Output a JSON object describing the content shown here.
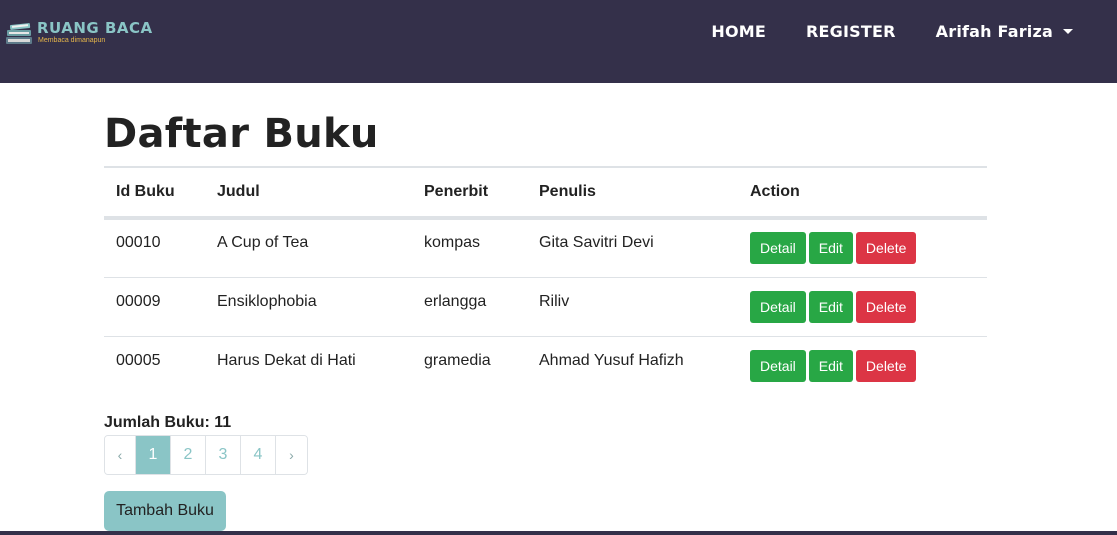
{
  "brand": {
    "name": "RUANG BACA",
    "tagline": "Membaca dimanapun"
  },
  "nav": {
    "home": "HOME",
    "register": "REGISTER",
    "user": "Arifah Fariza"
  },
  "page": {
    "title": "Daftar Buku"
  },
  "table": {
    "headers": {
      "id": "Id Buku",
      "judul": "Judul",
      "penerbit": "Penerbit",
      "penulis": "Penulis",
      "action": "Action"
    },
    "rows": [
      {
        "id": "00010",
        "judul": "A Cup of Tea",
        "penerbit": "kompas",
        "penulis": "Gita Savitri Devi"
      },
      {
        "id": "00009",
        "judul": "Ensiklophobia",
        "penerbit": "erlangga",
        "penulis": "Riliv"
      },
      {
        "id": "00005",
        "judul": "Harus Dekat di Hati",
        "penerbit": "gramedia",
        "penulis": "Ahmad Yusuf Hafizh"
      }
    ],
    "actions": {
      "detail": "Detail",
      "edit": "Edit",
      "delete": "Delete"
    }
  },
  "summary": {
    "count_label": "Jumlah Buku: 11"
  },
  "pagination": {
    "prev": "‹",
    "next": "›",
    "pages": [
      "1",
      "2",
      "3",
      "4"
    ],
    "active": "1"
  },
  "buttons": {
    "add": "Tambah Buku"
  },
  "colors": {
    "navbar": "#34304a",
    "accent": "#8ac5c6",
    "success": "#28a745",
    "danger": "#dc3545"
  }
}
